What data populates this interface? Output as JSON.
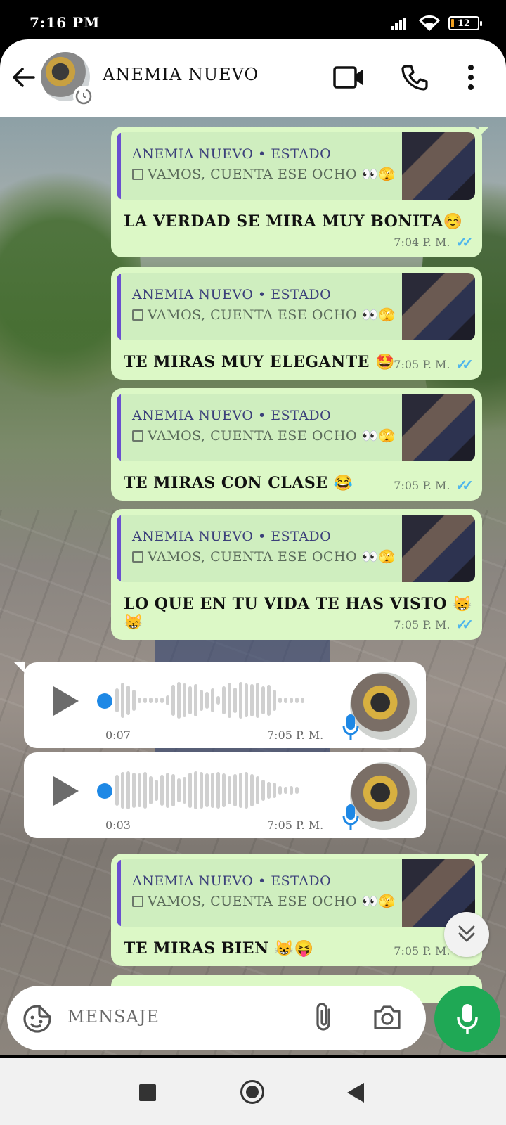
{
  "status_bar": {
    "time": "7:16 PM",
    "battery": "12"
  },
  "header": {
    "contact_name": "ANEMIA NUEVO"
  },
  "messages": [
    {
      "quote_name": "ANEMIA NUEVO • ESTADO",
      "quote_text": "VAMOS, CUENTA ESE OCHO 👀🫣",
      "text": "LA VERDAD SE MIRA MUY BONITA☺️",
      "time": "7:04 P. M."
    },
    {
      "quote_name": "ANEMIA NUEVO • ESTADO",
      "quote_text": "VAMOS, CUENTA ESE OCHO 👀🫣",
      "text": "TE MIRAS MUY ELEGANTE 🤩",
      "time": "7:05 P. M."
    },
    {
      "quote_name": "ANEMIA NUEVO • ESTADO",
      "quote_text": "VAMOS, CUENTA ESE OCHO 👀🫣",
      "text": "TE MIRAS CON CLASE 😂",
      "time": "7:05 P. M."
    },
    {
      "quote_name": "ANEMIA NUEVO • ESTADO",
      "quote_text": "VAMOS, CUENTA ESE OCHO 👀🫣",
      "text": "LO QUE EN TU VIDA TE HAS VISTO 😸😸",
      "time": "7:05 P. M."
    }
  ],
  "audios": [
    {
      "duration": "0:07",
      "time": "7:05 P. M."
    },
    {
      "duration": "0:03",
      "time": "7:05 P. M."
    }
  ],
  "last_message": {
    "quote_name": "ANEMIA NUEVO • ESTADO",
    "quote_text": "VAMOS, CUENTA ESE OCHO 👀🫣",
    "text": "TE MIRAS BIEN 😸😝",
    "time": "7:05 P. M."
  },
  "input": {
    "placeholder": "MENSAJE"
  },
  "colors": {
    "outgoing_bubble": "#dcf8c6",
    "tick": "#4fb6ec",
    "accent": "#1fa855",
    "quote_bar": "#6a4fd0"
  },
  "icons": [
    "back-arrow-icon",
    "video-call-icon",
    "phone-icon",
    "more-vert-icon",
    "sticker-icon",
    "attach-icon",
    "camera-icon",
    "mic-icon",
    "double-chevron-down-icon"
  ]
}
